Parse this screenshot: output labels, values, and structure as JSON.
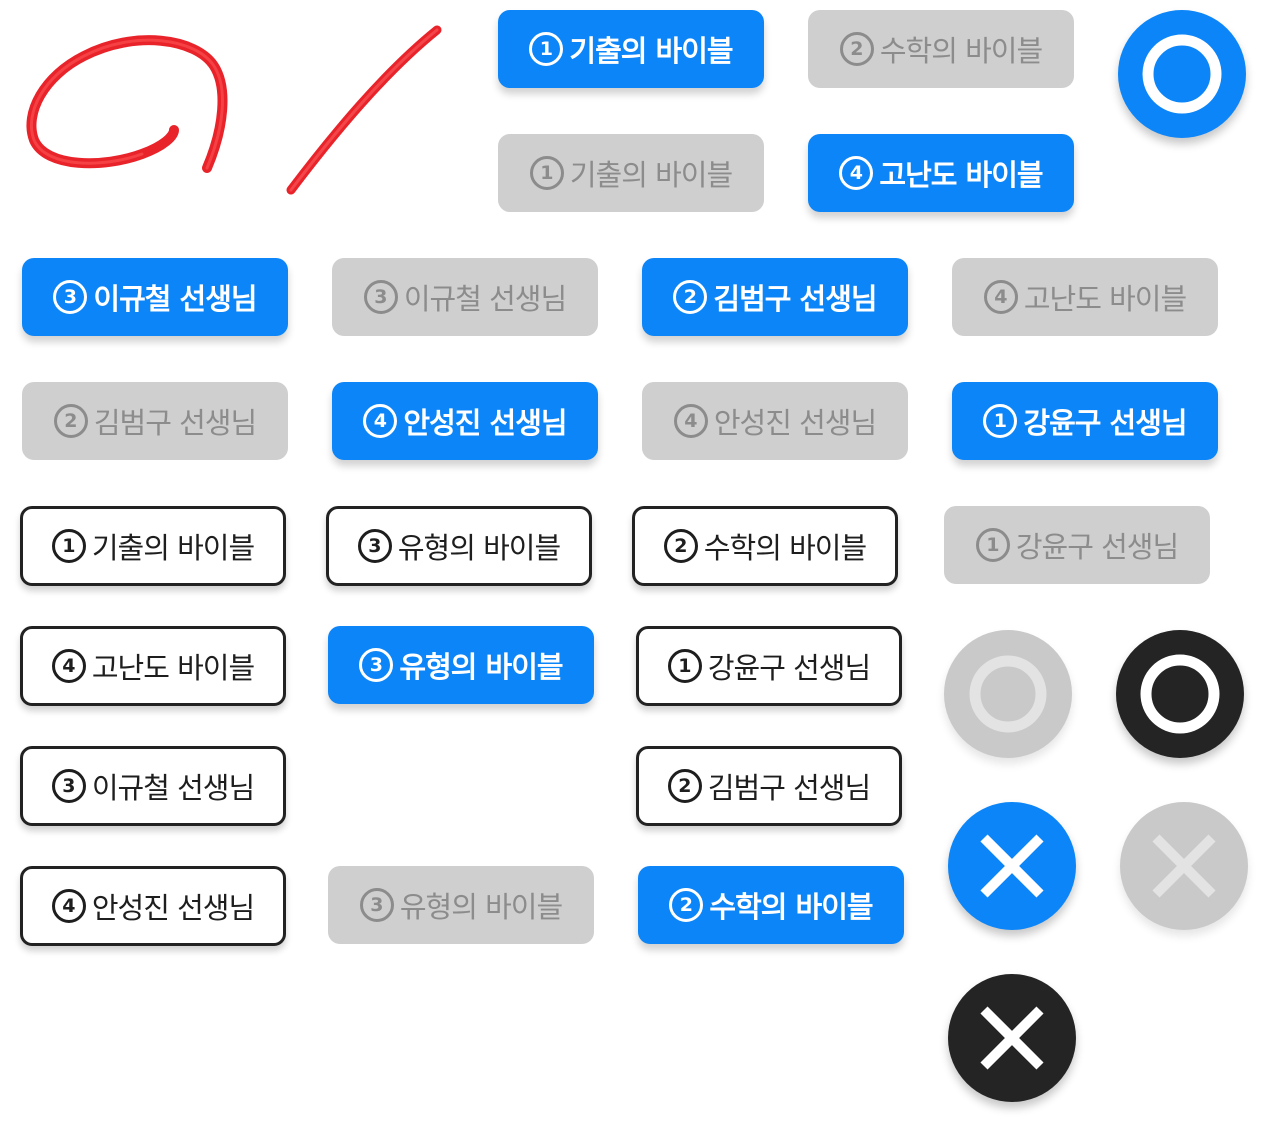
{
  "buttons": {
    "b1": {
      "num": "1",
      "label": "기출의 바이블"
    },
    "b2": {
      "num": "2",
      "label": "수학의 바이블"
    },
    "b3": {
      "num": "1",
      "label": "기출의 바이블"
    },
    "b4": {
      "num": "4",
      "label": "고난도 바이블"
    },
    "b5": {
      "num": "3",
      "label": "이규철 선생님"
    },
    "b6": {
      "num": "3",
      "label": "이규철 선생님"
    },
    "b7": {
      "num": "2",
      "label": "김범구 선생님"
    },
    "b8": {
      "num": "4",
      "label": "고난도 바이블"
    },
    "b9": {
      "num": "2",
      "label": "김범구 선생님"
    },
    "b10": {
      "num": "4",
      "label": "안성진 선생님"
    },
    "b11": {
      "num": "4",
      "label": "안성진 선생님"
    },
    "b12": {
      "num": "1",
      "label": "강윤구 선생님"
    },
    "b13": {
      "num": "1",
      "label": "기출의 바이블"
    },
    "b14": {
      "num": "3",
      "label": "유형의 바이블"
    },
    "b15": {
      "num": "2",
      "label": "수학의 바이블"
    },
    "b16": {
      "num": "1",
      "label": "강윤구 선생님"
    },
    "b17": {
      "num": "4",
      "label": "고난도 바이블"
    },
    "b18": {
      "num": "3",
      "label": "유형의 바이블"
    },
    "b19": {
      "num": "1",
      "label": "강윤구 선생님"
    },
    "b20": {
      "num": "3",
      "label": "이규철 선생님"
    },
    "b21": {
      "num": "2",
      "label": "김범구 선생님"
    },
    "b22": {
      "num": "4",
      "label": "안성진 선생님"
    },
    "b23": {
      "num": "3",
      "label": "유형의 바이블"
    },
    "b24": {
      "num": "2",
      "label": "수학의 바이블"
    }
  },
  "icons": {
    "marker_circle": "red-marker-circle-icon",
    "marker_slash": "red-marker-slash-icon",
    "o_mark": "circle-o-icon",
    "x_mark": "x-mark-icon"
  },
  "colors": {
    "accent_blue": "#0c85f8",
    "inactive_gray": "#cfcfcf",
    "inactive_text": "#8c8c8c",
    "dark": "#242424",
    "marker_red": "#e8232a"
  }
}
